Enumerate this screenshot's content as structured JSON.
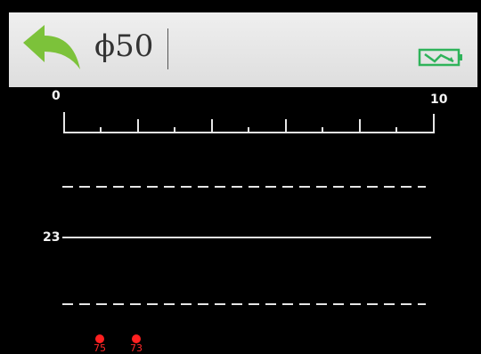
{
  "header": {
    "diameter_label": "ϕ50"
  },
  "icons": {
    "back": "back-arrow-icon",
    "battery": "battery-charging-icon"
  },
  "colors": {
    "header_bg": "#e6e6e6",
    "back_arrow": "#7cc23a",
    "battery": "#2fb35a",
    "marker": "#ff2020",
    "line": "#e6e6e6",
    "screen_bg": "#000000"
  },
  "scale": {
    "min_label": "0",
    "max_label": "10"
  },
  "reference": {
    "value_label": "23"
  },
  "markers": [
    {
      "label": "75"
    },
    {
      "label": "73"
    }
  ]
}
